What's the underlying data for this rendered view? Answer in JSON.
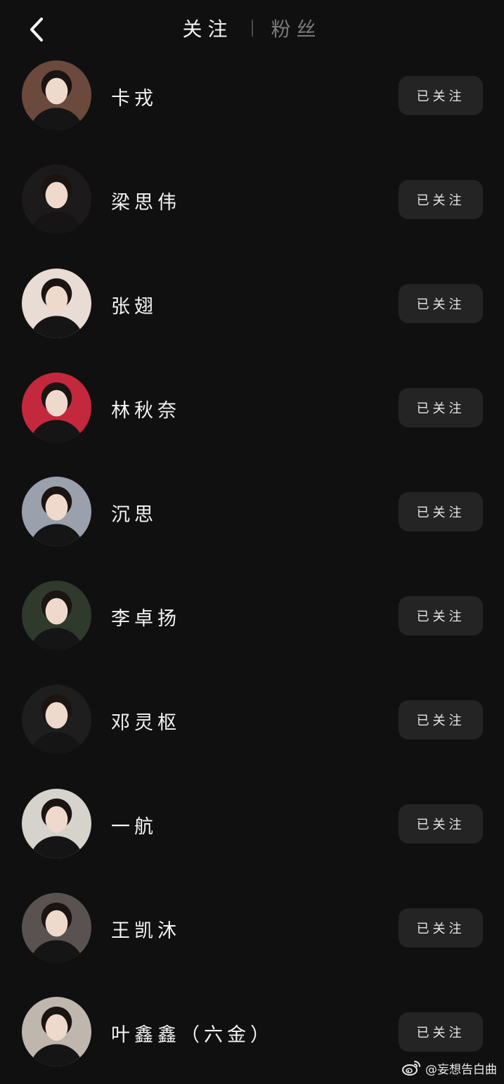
{
  "header": {
    "back_icon": "chevron-left-icon",
    "tabs": [
      {
        "label": "关注",
        "active": true
      },
      {
        "label": "粉丝",
        "active": false
      }
    ]
  },
  "follow_list": [
    {
      "name": "卡戎",
      "button": "已关注",
      "avatar_bg": "#6b4a3d"
    },
    {
      "name": "梁思伟",
      "button": "已关注",
      "avatar_bg": "#1c1a1a"
    },
    {
      "name": "张翅",
      "button": "已关注",
      "avatar_bg": "#e8dcd4"
    },
    {
      "name": "林秋奈",
      "button": "已关注",
      "avatar_bg": "#c4283c"
    },
    {
      "name": "沉思",
      "button": "已关注",
      "avatar_bg": "#9aa0ac"
    },
    {
      "name": "李卓扬",
      "button": "已关注",
      "avatar_bg": "#2f3a2c"
    },
    {
      "name": "邓灵枢",
      "button": "已关注",
      "avatar_bg": "#1e1e1e"
    },
    {
      "name": "一航",
      "button": "已关注",
      "avatar_bg": "#d6d2cc"
    },
    {
      "name": "王凯沐",
      "button": "已关注",
      "avatar_bg": "#5a5250"
    },
    {
      "name": "叶鑫鑫（六金）",
      "button": "已关注",
      "avatar_bg": "#bfb6ae"
    }
  ],
  "watermark": {
    "icon": "weibo-logo-icon",
    "text": "@妄想告白曲"
  }
}
